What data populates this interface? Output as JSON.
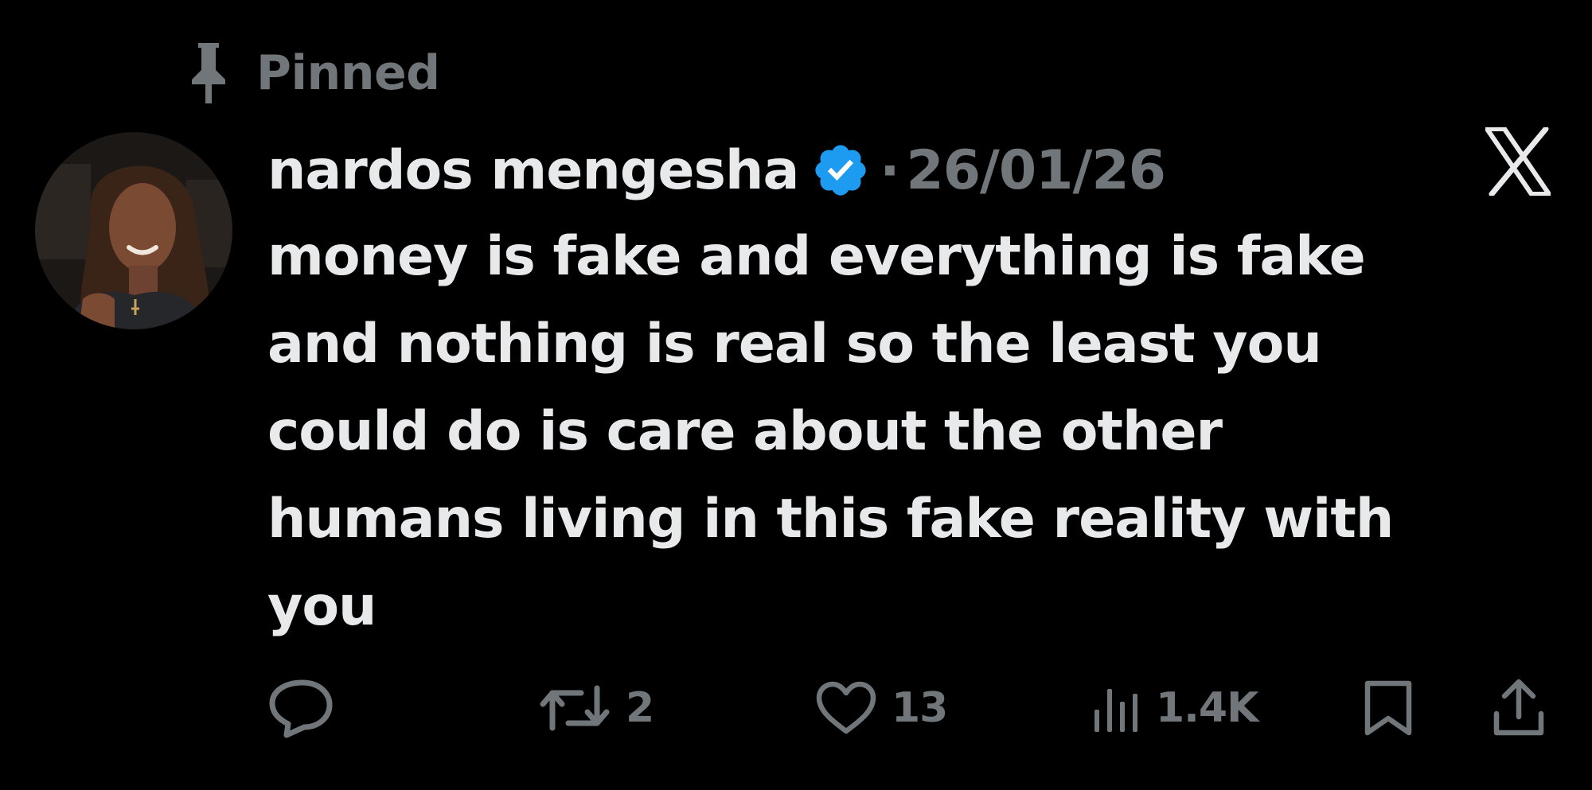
{
  "pinned": {
    "label": "Pinned",
    "icon": "pin-icon"
  },
  "author": {
    "display_name": "nardos mengesha",
    "verified": true,
    "verified_color": "#1d9bf0"
  },
  "post": {
    "separator": "·",
    "date": "26/01/26",
    "text_lines": [
      "money is fake and everything is fake",
      "and nothing is real so the least you",
      "could do is care about the other",
      "humans living in this fake reality with",
      "you"
    ]
  },
  "actions": {
    "reply": {
      "icon": "reply-icon"
    },
    "repost": {
      "icon": "repost-icon",
      "count": "2"
    },
    "like": {
      "icon": "heart-icon",
      "count": "13"
    },
    "views": {
      "icon": "views-icon",
      "count": "1.4K"
    },
    "bookmark": {
      "icon": "bookmark-icon"
    },
    "share": {
      "icon": "share-icon"
    }
  },
  "brand": {
    "logo": "x-logo-icon"
  },
  "colors": {
    "background": "#000000",
    "primary_text": "#e7e9ea",
    "secondary_text": "#71767b"
  }
}
